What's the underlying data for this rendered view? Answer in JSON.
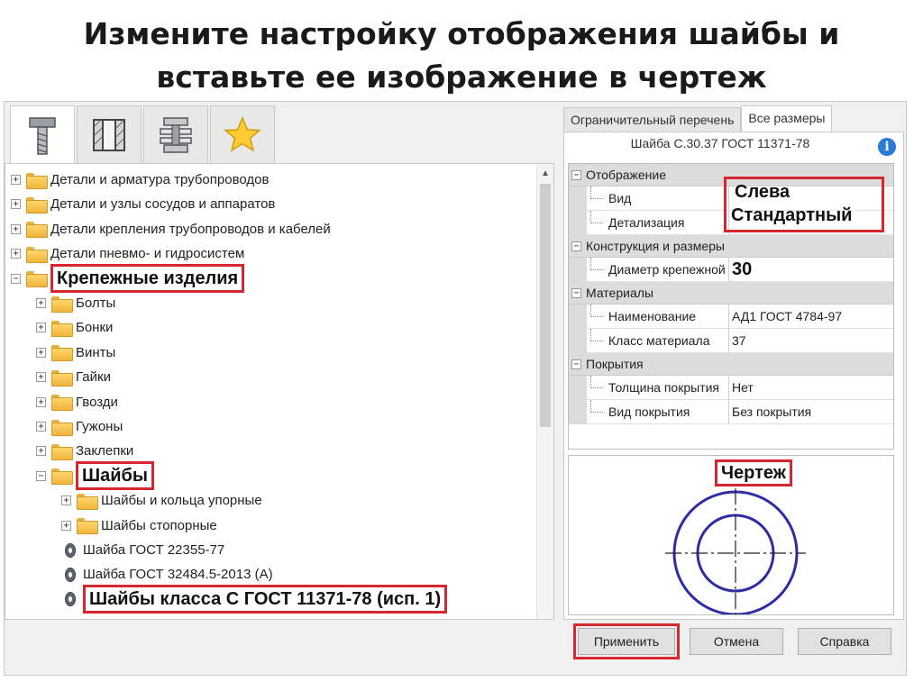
{
  "slide": {
    "title_line1": "Измените настройку отображения шайбы и",
    "title_line2": "вставьте ее изображение в чертеж"
  },
  "toolbar_tabs": [
    {
      "icon": "bolt-icon"
    },
    {
      "icon": "section-icon"
    },
    {
      "icon": "fastener-assembly-icon"
    },
    {
      "icon": "star-icon"
    }
  ],
  "tree": {
    "items": [
      {
        "label": "Детали и арматура трубопроводов",
        "level": 0,
        "expander": "+"
      },
      {
        "label": "Детали и узлы сосудов и аппаратов",
        "level": 0,
        "expander": "+"
      },
      {
        "label": "Детали крепления трубопроводов и кабелей",
        "level": 0,
        "expander": "+"
      },
      {
        "label": "Детали пневмо- и гидросистем",
        "level": 0,
        "expander": "+"
      },
      {
        "label": "Крепежные изделия",
        "level": 0,
        "expander": "−"
      },
      {
        "label": "Болты",
        "level": 1,
        "expander": "+"
      },
      {
        "label": "Бонки",
        "level": 1,
        "expander": "+"
      },
      {
        "label": "Винты",
        "level": 1,
        "expander": "+"
      },
      {
        "label": "Гайки",
        "level": 1,
        "expander": "+"
      },
      {
        "label": "Гвозди",
        "level": 1,
        "expander": "+"
      },
      {
        "label": "Гужоны",
        "level": 1,
        "expander": "+"
      },
      {
        "label": "Заклепки",
        "level": 1,
        "expander": "+"
      },
      {
        "label": "Шайбы",
        "level": 1,
        "expander": "−"
      },
      {
        "label": "Шайбы и кольца упорные",
        "level": 2,
        "expander": "+"
      },
      {
        "label": "Шайбы стопорные",
        "level": 2,
        "expander": "+"
      },
      {
        "label": "Шайба ГОСТ 22355-77",
        "level": 2,
        "expander": ""
      },
      {
        "label": "Шайба ГОСТ 32484.5-2013 (А)",
        "level": 2,
        "expander": ""
      },
      {
        "label": "Шайбы класса С ГОСТ 11371-78 (исп. 1)",
        "level": 2,
        "expander": ""
      }
    ]
  },
  "right_tabs": [
    {
      "label": "Ограничительный перечень"
    },
    {
      "label": "Все размеры"
    }
  ],
  "object_title": "Шайба С.30.37 ГОСТ 11371-78",
  "info_symbol": "i",
  "properties": {
    "cat_display": "Отображение",
    "vid_name": "Вид",
    "vid_value": "Слева",
    "detail_name": "Детализация",
    "detail_value": "Стандартный",
    "cat_construction": "Конструкция и размеры",
    "diameter_name": "Диаметр крепежной детали",
    "diameter_value": "30",
    "cat_materials": "Материалы",
    "material_name": "Наименование",
    "material_value": "АД1 ГОСТ 4784-97",
    "class_name": "Класс материала",
    "class_value": "37",
    "cat_coating": "Покрытия",
    "thickness_name": "Толщина покрытия",
    "thickness_value": "Нет",
    "coating_type_name": "Вид покрытия",
    "coating_type_value": "Без покрытия"
  },
  "drawing_label": "Чертеж",
  "buttons": {
    "apply": "Применить",
    "cancel": "Отмена",
    "help": "Справка"
  },
  "colors": {
    "highlight": "#d8262e",
    "washer_drawing": "#2d2ea6",
    "folder": "#f0b43c"
  }
}
